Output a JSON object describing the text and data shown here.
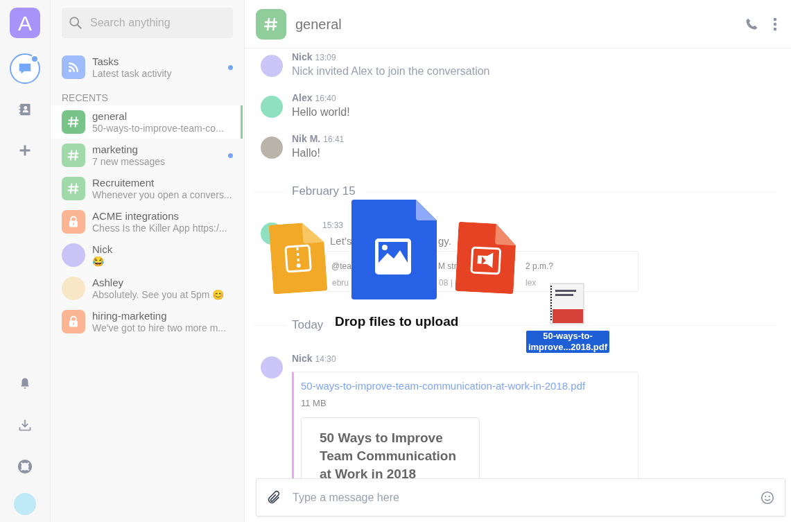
{
  "rail": {
    "logo_letter": "A",
    "items": [
      {
        "kind": "chat",
        "selected": true,
        "unread": true
      },
      {
        "kind": "contacts",
        "selected": false,
        "unread": false
      },
      {
        "kind": "add",
        "selected": false,
        "unread": false
      }
    ],
    "bottom": [
      {
        "kind": "bell"
      },
      {
        "kind": "download"
      },
      {
        "kind": "help"
      },
      {
        "kind": "avatar"
      }
    ]
  },
  "sidebar": {
    "search": {
      "placeholder": "Search anything"
    },
    "tasks": {
      "title": "Tasks",
      "subtitle": "Latest task activity",
      "unread": true
    },
    "section": "RECENTS",
    "items": [
      {
        "kind": "channel",
        "title": "general",
        "subtitle": "50-ways-to-improve-team-co...",
        "selected": true,
        "unread": false
      },
      {
        "kind": "channel",
        "title": "marketing",
        "subtitle": "7 new messages",
        "selected": false,
        "unread": true
      },
      {
        "kind": "channel",
        "title": "Recruitement",
        "subtitle": "Whenever you open a convers...",
        "selected": false,
        "unread": false
      },
      {
        "kind": "private",
        "title": "ACME integrations",
        "subtitle": "Chess Is the Killer App https:/...",
        "selected": false,
        "unread": false
      },
      {
        "kind": "direct",
        "title": "Nick",
        "subtitle": "😂",
        "color": "#c9c3f7",
        "selected": false,
        "unread": false
      },
      {
        "kind": "direct",
        "title": "Ashley",
        "subtitle": "Absolutely. See you at 5pm 😊",
        "color": "#f7e7c6",
        "selected": false,
        "unread": false
      },
      {
        "kind": "private",
        "title": "hiring-marketing",
        "subtitle": "We've got to hire two more m...",
        "selected": false,
        "unread": false
      }
    ]
  },
  "header": {
    "title": "general"
  },
  "messages": [
    {
      "kind": "event",
      "author": "Nick",
      "color": "#cbc5f8",
      "time": "13:09",
      "text": "Nick invited Alex to join the conversation"
    },
    {
      "kind": "message",
      "author": "Alex",
      "color": "#8ee0c0",
      "time": "16:40",
      "text": "Hello world!"
    },
    {
      "kind": "message",
      "author": "Nik M.",
      "color": "#b9b3aa",
      "time": "16:41",
      "text": "Hallo!"
    },
    {
      "kind": "date",
      "text": "February 15"
    },
    {
      "kind": "obscured",
      "color": "#8ee0c0",
      "time": "15:33",
      "line": [
        "Let’s",
        "gy."
      ],
      "quote": [
        "@tea",
        "M str",
        "2 p.m.?"
      ],
      "quote_meta": [
        "ebru",
        "08 |",
        "lex"
      ]
    },
    {
      "kind": "date",
      "text": "Today"
    },
    {
      "kind": "file",
      "author": "Nick",
      "color": "#cbc5f8",
      "time": "14:30",
      "file_name": "50-ways-to-improve-team-communication-at-work-in-2018.pdf",
      "size": "11 MB",
      "preview_title": "50 Ways to Improve Team Communication at Work in 2018"
    }
  ],
  "drop_overlay": {
    "title": "Drop files to upload",
    "dragged_file": "50-ways-to-improve...2018.pdf"
  },
  "composer": {
    "placeholder": "Type a message here"
  }
}
